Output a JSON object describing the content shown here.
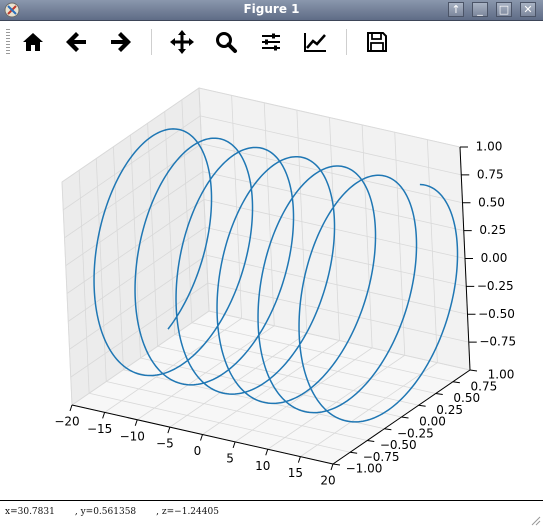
{
  "window": {
    "title": "Figure 1",
    "controls": [
      "↑",
      "_",
      "□",
      "✕"
    ]
  },
  "toolbar": {
    "items": [
      {
        "name": "home-icon",
        "label": "Home"
      },
      {
        "name": "back-arrow-icon",
        "label": "Back"
      },
      {
        "name": "forward-arrow-icon",
        "label": "Forward"
      },
      {
        "name": "pan-icon",
        "label": "Pan"
      },
      {
        "name": "zoom-icon",
        "label": "Zoom"
      },
      {
        "name": "subplots-icon",
        "label": "Subplots"
      },
      {
        "name": "customize-icon",
        "label": "Customize"
      },
      {
        "name": "save-icon",
        "label": "Save"
      }
    ]
  },
  "status": {
    "coords": "x=30.7831       , y=0.561358       , z=−1.24405"
  },
  "colors": {
    "line": "#1f77b4",
    "pane": "#f2f2f2",
    "grid": "#d9d9d9"
  },
  "chart_data": {
    "type": "line",
    "projection": "3d",
    "series": [
      {
        "parametric": "x = t, y = cos(t), z = sin(t)",
        "t_range": [
          -20,
          20
        ]
      }
    ],
    "x_ticks": [
      "−20",
      "−15",
      "−10",
      "−5",
      "0",
      "5",
      "10",
      "15",
      "20"
    ],
    "y_ticks": [
      "−1.00",
      "−0.75",
      "−0.50",
      "−0.25",
      "0.00",
      "0.25",
      "0.50",
      "0.75",
      "1.00"
    ],
    "z_ticks": [
      "−0.75",
      "−0.50",
      "−0.25",
      "0.00",
      "0.25",
      "0.50",
      "0.75",
      "1.00"
    ],
    "xlim": [
      -20,
      20
    ],
    "ylim": [
      -1,
      1
    ],
    "zlim": [
      -1,
      1
    ],
    "grid": true
  }
}
